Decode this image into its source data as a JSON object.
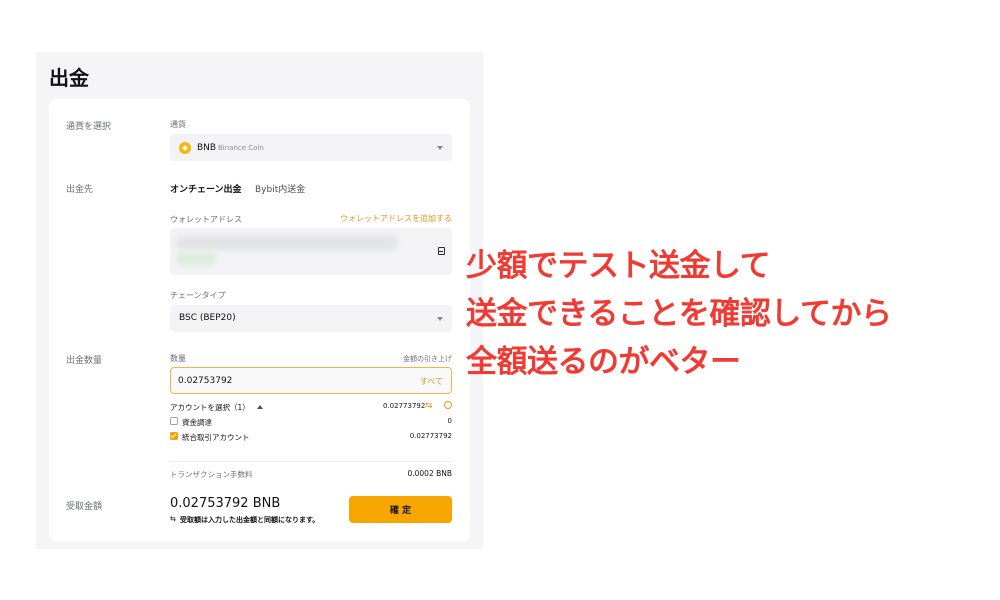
{
  "page": {
    "title": "出金"
  },
  "currency": {
    "row_label": "通貨を選択",
    "field_label": "通貨",
    "selected_symbol": "BNB",
    "selected_name": "Binance Coin"
  },
  "destination": {
    "row_label": "出金先",
    "tabs": [
      "オンチェーン出金",
      "Bybit内送金"
    ],
    "address_label": "ウォレットアドレス",
    "add_address_link": "ウォレットアドレスを追加する",
    "chain_label": "チェーンタイプ",
    "chain_value": "BSC (BEP20)"
  },
  "amount": {
    "row_label": "出金数量",
    "field_label": "数量",
    "limit_link": "金額の引き上げ",
    "value": "0.02753792",
    "all_label": "すべて",
    "account_select_label": "アカウントを選択（1）",
    "account_total": "0.02773792",
    "accounts": [
      {
        "name": "資金調達",
        "value": "0",
        "checked": false
      },
      {
        "name": "統合取引アカウント",
        "value": "0.02773792",
        "checked": true
      }
    ],
    "fee_label": "トランザクション手数料",
    "fee_value": "0.0002 BNB"
  },
  "receive": {
    "row_label": "受取金額",
    "amount": "0.02753792 BNB",
    "note": "受取額は入力した出金額と同額になります。",
    "confirm_label": "確 定"
  },
  "annotation": {
    "lines": [
      "少額でテスト送金して",
      "送金できることを確認してから",
      "全額送るのがベター"
    ],
    "color": "#ef3b33"
  },
  "colors": {
    "accent": "#f7a600",
    "link": "#e5951c"
  }
}
